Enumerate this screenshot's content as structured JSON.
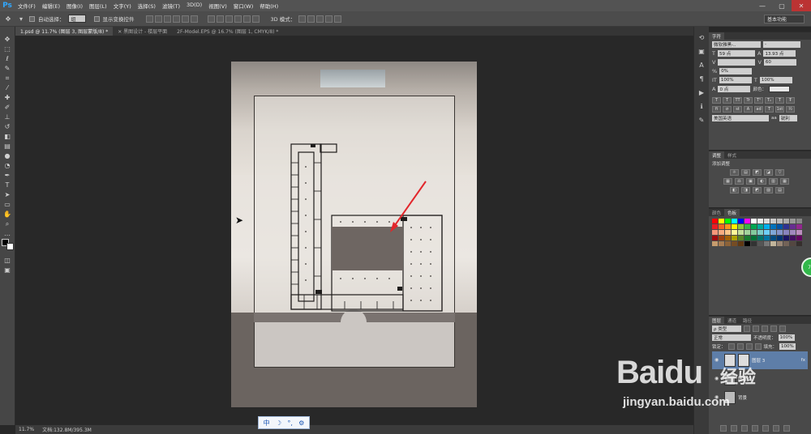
{
  "app": {
    "logo": "Ps"
  },
  "menubar": {
    "items": [
      "文件(F)",
      "编辑(E)",
      "图像(I)",
      "图层(L)",
      "文字(Y)",
      "选择(S)",
      "滤镜(T)",
      "3D(D)",
      "视图(V)",
      "窗口(W)",
      "帮助(H)"
    ],
    "window_controls": [
      "—",
      "▢",
      "✕"
    ]
  },
  "options_bar": {
    "auto_select_label": "自动选择：",
    "auto_select_value": "组",
    "show_transform_label": "显示变换控件",
    "mode_3d_label": "3D 模式：",
    "workspace": "基本功能"
  },
  "doc_tabs": [
    {
      "label": "1.psd @ 11.7% (图层 3, 图层蒙版/8) *",
      "active": true
    },
    {
      "label": "✕ 黑图设计 - 楼层平面",
      "active": false
    },
    {
      "label": "2F-Model.EPS @ 16.7% (图层 1, CMYK/8) *",
      "active": false
    }
  ],
  "status_bar": {
    "zoom": "11.7%",
    "doc_info": "文档:132.8M/395.3M"
  },
  "ime_bar": {
    "items": [
      "中",
      "☽",
      "°,",
      "⚙"
    ]
  },
  "character_panel": {
    "tab": "字符",
    "font_family": "微软雅黑-..",
    "font_style": "-",
    "font_size": "59 点",
    "leading": "13.93 点",
    "kerning": "",
    "tracking": "60",
    "scale_pct": "0%",
    "vscale": "100%",
    "hscale": "100%",
    "baseline": "0 点",
    "color_label": "颜色：",
    "lang": "美国英语",
    "aa": "锐利",
    "aa_prefix": "aa",
    "style_buttons": [
      "T",
      "T",
      "TT",
      "Tr",
      "T¹",
      "T₁",
      "T",
      "Ŧ"
    ],
    "ot_buttons": [
      "fi",
      "σ",
      "st",
      "A",
      "ad",
      "T",
      "1st",
      "½"
    ]
  },
  "adjust_panel": {
    "tabs": [
      "调整",
      "样式"
    ],
    "title": "添加调整",
    "row1": [
      "☼",
      "▤",
      "◩",
      "◪",
      "▽"
    ],
    "row2": [
      "▦",
      "⚖",
      "▣",
      "◐",
      "▥",
      "▦"
    ],
    "row3": [
      "◧",
      "◨",
      "◩",
      "▨",
      "▤"
    ]
  },
  "color_panel": {
    "tabs": [
      "颜色",
      "色板"
    ],
    "swatches": [
      "#ff0000",
      "#ffff00",
      "#00ff00",
      "#00ffff",
      "#0000ff",
      "#ff00ff",
      "#ffffff",
      "#eeeeee",
      "#dddddd",
      "#cccccc",
      "#bbbbbb",
      "#aaaaaa",
      "#999999",
      "#888888",
      "#ed1c24",
      "#f26522",
      "#f7941d",
      "#fff200",
      "#8dc63f",
      "#39b54a",
      "#00a651",
      "#00a99d",
      "#00aeef",
      "#0072bc",
      "#0054a6",
      "#2e3192",
      "#662d91",
      "#92278f",
      "#f7977a",
      "#f9ad81",
      "#fdc68a",
      "#fff79a",
      "#c4df9b",
      "#a3d39c",
      "#82ca9d",
      "#7bcdc8",
      "#6ecff6",
      "#7ea7d8",
      "#8493ca",
      "#8882be",
      "#a187be",
      "#bc8dbf",
      "#9e0b0f",
      "#a0410d",
      "#a36209",
      "#aba000",
      "#598527",
      "#1a7b30",
      "#007236",
      "#00746b",
      "#0076a3",
      "#004b80",
      "#003471",
      "#1b1464",
      "#440e62",
      "#630460",
      "#c69c6d",
      "#a67c52",
      "#8c6239",
      "#754c24",
      "#603913",
      "#000000",
      "#333333",
      "#555555",
      "#777777",
      "#c2b59b",
      "#998675",
      "#736357",
      "#534741",
      "#362f2d"
    ]
  },
  "layers_panel": {
    "tabs": [
      "图层",
      "通道",
      "路径"
    ],
    "kind": "ρ 类型",
    "blend": "正常",
    "opacity_label": "不透明度：",
    "opacity": "100%",
    "lock_label": "锁定：",
    "fill_label": "填充：",
    "fill": "100%",
    "layers": [
      {
        "name": "图层 3",
        "selected": true
      },
      {
        "name": "图层 2",
        "selected": false
      },
      {
        "name": "背景",
        "selected": false
      }
    ],
    "fx": "fx"
  },
  "watermark": {
    "brand": "Bai",
    "brand2": "du",
    "cn": "经验",
    "url": "jingyan.baidu.com"
  },
  "badge": "75"
}
